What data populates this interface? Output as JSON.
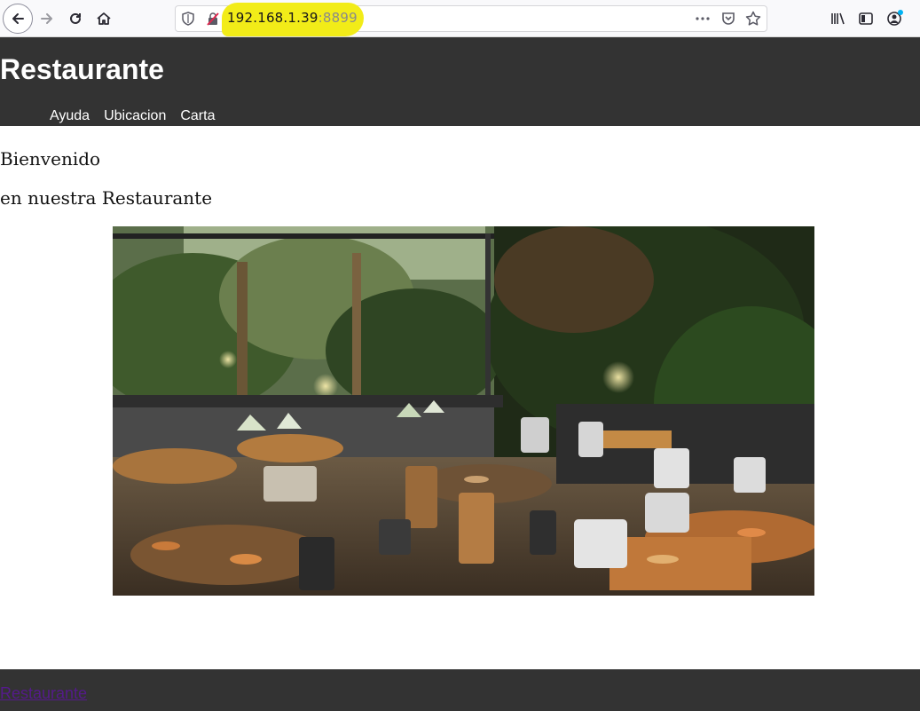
{
  "browser": {
    "url_host": "192.168.1.39",
    "url_port": ":8899",
    "icons": [
      "back-icon",
      "forward-icon",
      "reload-icon",
      "home-icon",
      "shield-icon",
      "insecure-lock-icon",
      "more-icon",
      "pocket-icon",
      "star-icon",
      "library-icon",
      "sidebar-icon",
      "account-icon"
    ]
  },
  "header": {
    "title": "Restaurante",
    "nav": [
      {
        "label": "Ayuda"
      },
      {
        "label": "Ubicacion"
      },
      {
        "label": "Carta"
      }
    ]
  },
  "main": {
    "welcome": "Bienvenido",
    "subtitle": "en nuestra Restaurante",
    "image": "restaurant-interior-photo"
  },
  "footer": {
    "link": "Restaurante"
  },
  "colors": {
    "header_bg": "#333333",
    "footer_link": "#551a8b",
    "url_highlight": "#f2ec18"
  }
}
